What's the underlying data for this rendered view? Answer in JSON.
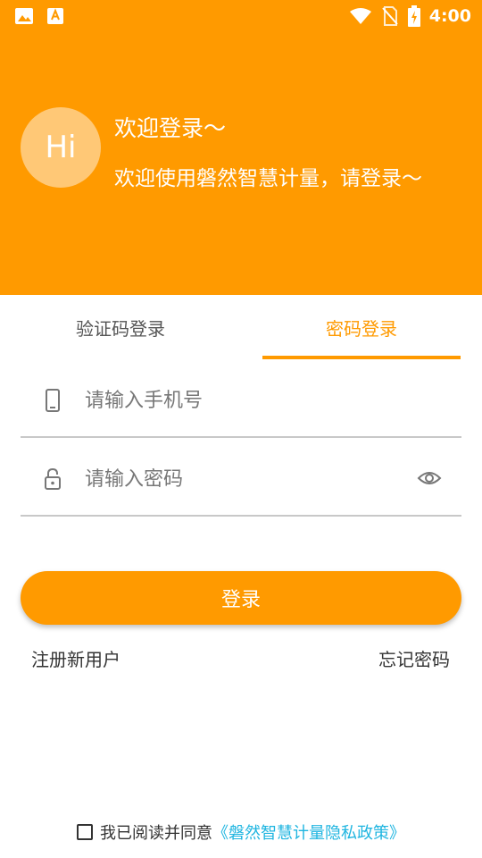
{
  "status_bar": {
    "time": "4:00",
    "icons": [
      "gallery-icon",
      "font-app-icon",
      "wifi-icon",
      "no-sim-icon",
      "battery-charging-icon"
    ]
  },
  "header": {
    "avatar_text": "Hi",
    "title": "欢迎登录～",
    "subtitle": "欢迎使用磐然智慧计量，请登录～",
    "background_color": "#FF9A00"
  },
  "tabs": [
    {
      "label": "验证码登录",
      "active": false
    },
    {
      "label": "密码登录",
      "active": true
    }
  ],
  "form": {
    "phone": {
      "value": "",
      "placeholder": "请输入手机号",
      "icon": "phone-icon"
    },
    "password": {
      "value": "",
      "placeholder": "请输入密码",
      "icon": "lock-icon",
      "toggle_icon": "eye-icon"
    }
  },
  "login_button": {
    "label": "登录"
  },
  "links": {
    "register": "注册新用户",
    "forgot": "忘记密码"
  },
  "agreement": {
    "checked": false,
    "text": "我已阅读并同意",
    "policy_link": "《磐然智慧计量隐私政策》",
    "link_color": "#1FB5E0"
  },
  "colors": {
    "accent": "#FF9A00",
    "divider": "#C8C8C8"
  }
}
